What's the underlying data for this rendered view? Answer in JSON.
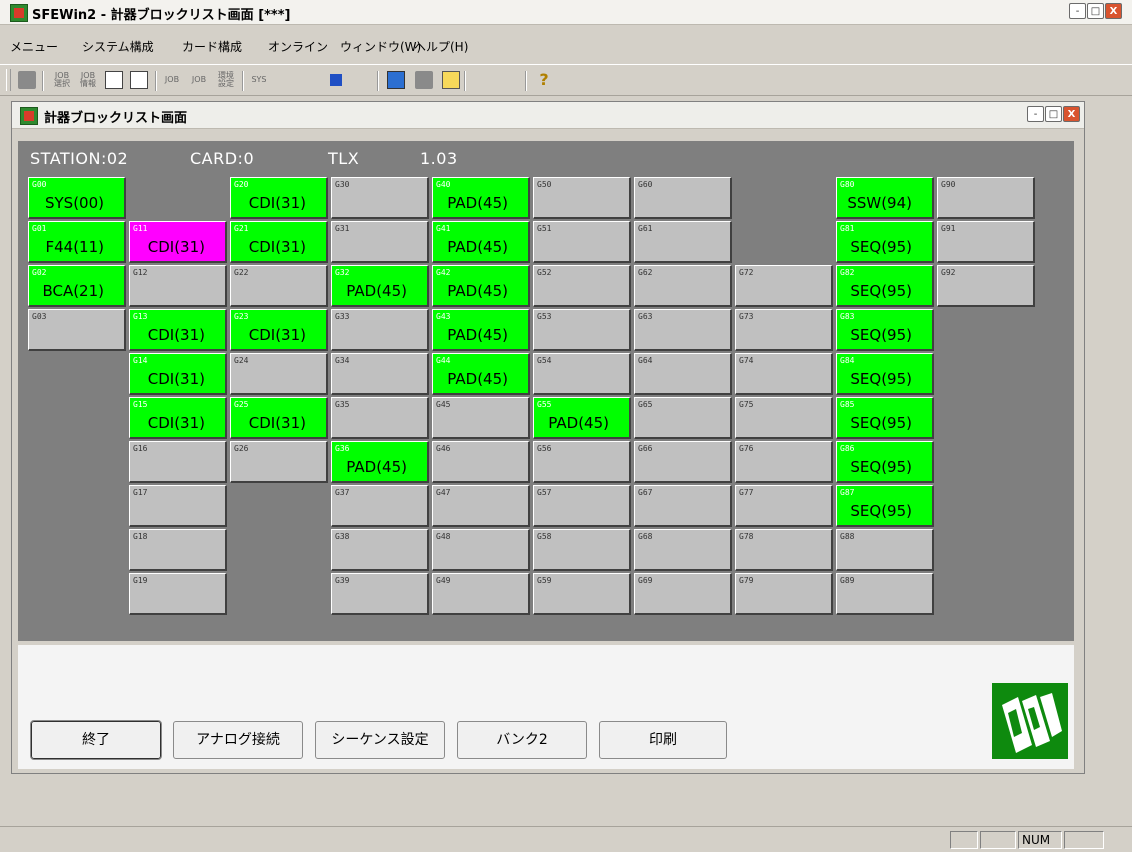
{
  "app": {
    "title": "SFEWin2 - 計器ブロックリスト画面 [***]",
    "window_buttons": [
      "-",
      "□",
      "X"
    ]
  },
  "menu": [
    "メニュー",
    "システム構成",
    "カード構成",
    "オンライン",
    "ウィンドウ(W)",
    "ヘルプ(H)"
  ],
  "toolbar": [
    {
      "icon": "doc-icon",
      "text": ""
    },
    {
      "icon": "job-select-icon",
      "text": "JOB\n選択"
    },
    {
      "icon": "job-info-icon",
      "text": "JOB\n情報"
    },
    {
      "icon": "grid-icon",
      "text": ""
    },
    {
      "icon": "screen-icon",
      "text": ""
    },
    {
      "icon": "job-upload-icon",
      "text": "JOB"
    },
    {
      "icon": "job-download-icon",
      "text": "JOB"
    },
    {
      "icon": "env-settings-icon",
      "text": "環境\n設定"
    },
    {
      "icon": "sys-icon",
      "text": "SYS"
    },
    {
      "icon": "lightning-icon",
      "text": ""
    },
    {
      "icon": "page-icon",
      "text": ""
    },
    {
      "icon": "network-icon",
      "text": ""
    },
    {
      "icon": "wave-icon",
      "text": ""
    },
    {
      "icon": "monitor-icon",
      "text": ""
    },
    {
      "icon": "block-icon",
      "text": ""
    },
    {
      "icon": "list-icon",
      "text": ""
    },
    {
      "icon": "undo-icon",
      "text": ""
    },
    {
      "icon": "redo-icon",
      "text": ""
    },
    {
      "icon": "help-icon",
      "text": "?"
    }
  ],
  "child_window": {
    "title": "計器ブロックリスト画面"
  },
  "status": {
    "station": "STATION:02",
    "card": "CARD:0",
    "type": "TLX",
    "version": "1.03"
  },
  "grid": {
    "rows": [
      [
        {
          "code": "G00",
          "value": "SYS(00)",
          "state": "on"
        },
        null,
        {
          "code": "G20",
          "value": "CDI(31)",
          "state": "on"
        },
        {
          "code": "G30",
          "value": "",
          "state": "off"
        },
        {
          "code": "G40",
          "value": "PAD(45)",
          "state": "on"
        },
        {
          "code": "G50",
          "value": "",
          "state": "off"
        },
        {
          "code": "G60",
          "value": "",
          "state": "off"
        },
        null,
        {
          "code": "G80",
          "value": "SSW(94)",
          "state": "on"
        },
        {
          "code": "G90",
          "value": "",
          "state": "off"
        }
      ],
      [
        {
          "code": "G01",
          "value": "F44(11)",
          "state": "on"
        },
        {
          "code": "G11",
          "value": "CDI(31)",
          "state": "pink"
        },
        {
          "code": "G21",
          "value": "CDI(31)",
          "state": "on"
        },
        {
          "code": "G31",
          "value": "",
          "state": "off"
        },
        {
          "code": "G41",
          "value": "PAD(45)",
          "state": "on"
        },
        {
          "code": "G51",
          "value": "",
          "state": "off"
        },
        {
          "code": "G61",
          "value": "",
          "state": "off"
        },
        null,
        {
          "code": "G81",
          "value": "SEQ(95)",
          "state": "on"
        },
        {
          "code": "G91",
          "value": "",
          "state": "off"
        }
      ],
      [
        {
          "code": "G02",
          "value": "BCA(21)",
          "state": "on"
        },
        {
          "code": "G12",
          "value": "",
          "state": "off"
        },
        {
          "code": "G22",
          "value": "",
          "state": "off"
        },
        {
          "code": "G32",
          "value": "PAD(45)",
          "state": "on"
        },
        {
          "code": "G42",
          "value": "PAD(45)",
          "state": "on"
        },
        {
          "code": "G52",
          "value": "",
          "state": "off"
        },
        {
          "code": "G62",
          "value": "",
          "state": "off"
        },
        {
          "code": "G72",
          "value": "",
          "state": "off"
        },
        {
          "code": "G82",
          "value": "SEQ(95)",
          "state": "on"
        },
        {
          "code": "G92",
          "value": "",
          "state": "off"
        }
      ],
      [
        {
          "code": "G03",
          "value": "",
          "state": "off"
        },
        {
          "code": "G13",
          "value": "CDI(31)",
          "state": "on"
        },
        {
          "code": "G23",
          "value": "CDI(31)",
          "state": "on"
        },
        {
          "code": "G33",
          "value": "",
          "state": "off"
        },
        {
          "code": "G43",
          "value": "PAD(45)",
          "state": "on"
        },
        {
          "code": "G53",
          "value": "",
          "state": "off"
        },
        {
          "code": "G63",
          "value": "",
          "state": "off"
        },
        {
          "code": "G73",
          "value": "",
          "state": "off"
        },
        {
          "code": "G83",
          "value": "SEQ(95)",
          "state": "on"
        },
        null
      ],
      [
        null,
        {
          "code": "G14",
          "value": "CDI(31)",
          "state": "on"
        },
        {
          "code": "G24",
          "value": "",
          "state": "off"
        },
        {
          "code": "G34",
          "value": "",
          "state": "off"
        },
        {
          "code": "G44",
          "value": "PAD(45)",
          "state": "on"
        },
        {
          "code": "G54",
          "value": "",
          "state": "off"
        },
        {
          "code": "G64",
          "value": "",
          "state": "off"
        },
        {
          "code": "G74",
          "value": "",
          "state": "off"
        },
        {
          "code": "G84",
          "value": "SEQ(95)",
          "state": "on"
        },
        null
      ],
      [
        null,
        {
          "code": "G15",
          "value": "CDI(31)",
          "state": "on"
        },
        {
          "code": "G25",
          "value": "CDI(31)",
          "state": "on"
        },
        {
          "code": "G35",
          "value": "",
          "state": "off"
        },
        {
          "code": "G45",
          "value": "",
          "state": "off"
        },
        {
          "code": "G55",
          "value": "PAD(45)",
          "state": "on"
        },
        {
          "code": "G65",
          "value": "",
          "state": "off"
        },
        {
          "code": "G75",
          "value": "",
          "state": "off"
        },
        {
          "code": "G85",
          "value": "SEQ(95)",
          "state": "on"
        },
        null
      ],
      [
        null,
        {
          "code": "G16",
          "value": "",
          "state": "off"
        },
        {
          "code": "G26",
          "value": "",
          "state": "off"
        },
        {
          "code": "G36",
          "value": "PAD(45)",
          "state": "on"
        },
        {
          "code": "G46",
          "value": "",
          "state": "off"
        },
        {
          "code": "G56",
          "value": "",
          "state": "off"
        },
        {
          "code": "G66",
          "value": "",
          "state": "off"
        },
        {
          "code": "G76",
          "value": "",
          "state": "off"
        },
        {
          "code": "G86",
          "value": "SEQ(95)",
          "state": "on"
        },
        null
      ],
      [
        null,
        {
          "code": "G17",
          "value": "",
          "state": "off"
        },
        null,
        {
          "code": "G37",
          "value": "",
          "state": "off"
        },
        {
          "code": "G47",
          "value": "",
          "state": "off"
        },
        {
          "code": "G57",
          "value": "",
          "state": "off"
        },
        {
          "code": "G67",
          "value": "",
          "state": "off"
        },
        {
          "code": "G77",
          "value": "",
          "state": "off"
        },
        {
          "code": "G87",
          "value": "SEQ(95)",
          "state": "on"
        },
        null
      ],
      [
        null,
        {
          "code": "G18",
          "value": "",
          "state": "off"
        },
        null,
        {
          "code": "G38",
          "value": "",
          "state": "off"
        },
        {
          "code": "G48",
          "value": "",
          "state": "off"
        },
        {
          "code": "G58",
          "value": "",
          "state": "off"
        },
        {
          "code": "G68",
          "value": "",
          "state": "off"
        },
        {
          "code": "G78",
          "value": "",
          "state": "off"
        },
        {
          "code": "G88",
          "value": "",
          "state": "off"
        },
        null
      ],
      [
        null,
        {
          "code": "G19",
          "value": "",
          "state": "off"
        },
        null,
        {
          "code": "G39",
          "value": "",
          "state": "off"
        },
        {
          "code": "G49",
          "value": "",
          "state": "off"
        },
        {
          "code": "G59",
          "value": "",
          "state": "off"
        },
        {
          "code": "G69",
          "value": "",
          "state": "off"
        },
        {
          "code": "G79",
          "value": "",
          "state": "off"
        },
        {
          "code": "G89",
          "value": "",
          "state": "off"
        },
        null
      ]
    ]
  },
  "buttons": [
    "終了",
    "アナログ接続",
    "シーケンス設定",
    "バンク2",
    "印刷"
  ],
  "statusbar": {
    "num": "NUM"
  },
  "colors": {
    "on": "#00ff00",
    "pink": "#ff00ff",
    "off": "#c0c0c0",
    "board": "#7f7f7f"
  }
}
